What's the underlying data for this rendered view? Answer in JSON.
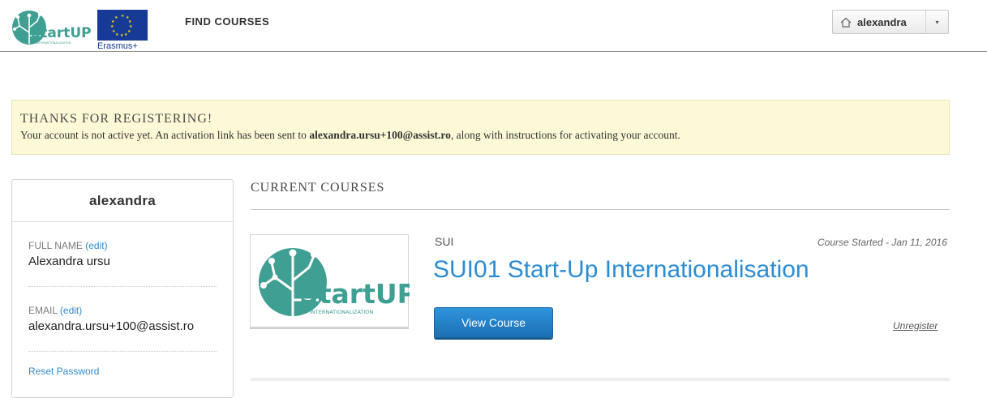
{
  "header": {
    "logo_text": "StartUP",
    "logo_subtext": "INTERNATIONALIZATION",
    "eu_logo_text": "Erasmus+",
    "nav_find_courses": "FIND COURSES",
    "user_menu": {
      "username": "alexandra",
      "home_icon": "home-icon",
      "caret_icon": "caret-down-icon"
    }
  },
  "banner": {
    "title": "THANKS FOR REGISTERING!",
    "message_before": "Your account is not active yet. An activation link has been sent to ",
    "email": "alexandra.ursu+100@assist.ro",
    "message_after": ", along with instructions for activating your account."
  },
  "profile": {
    "username": "alexandra",
    "full_name_label": "FULL NAME",
    "full_name_edit": "(edit)",
    "full_name_value": "Alexandra ursu",
    "email_label": "EMAIL",
    "email_edit": "(edit)",
    "email_value": "alexandra.ursu+100@assist.ro",
    "reset_password": "Reset Password"
  },
  "courses": {
    "section_title": "CURRENT COURSES",
    "items": [
      {
        "org": "SUI",
        "status": "Course Started - Jan 11, 2016",
        "title": "SUI01 Start-Up Internationalisation",
        "view_label": "View Course",
        "unregister_label": "Unregister",
        "image_logo_text": "StartUP",
        "image_logo_subtext": "INTERNATIONALIZATION"
      }
    ]
  },
  "colors": {
    "brand_teal": "#3f9f92",
    "brand_navy": "#1d3f6e",
    "link_blue": "#2c8dd3",
    "banner_bg": "#fdf9d7",
    "eu_blue": "#163a96",
    "eu_star": "#ffdd00"
  }
}
